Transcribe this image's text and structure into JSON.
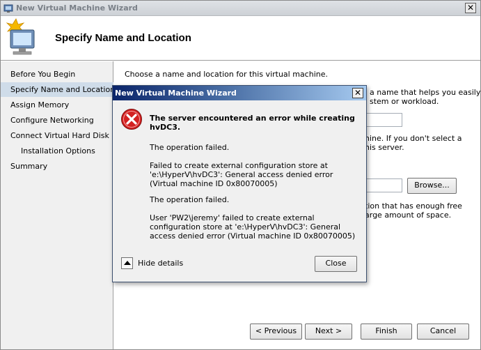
{
  "window": {
    "title": "New Virtual Machine Wizard",
    "close_glyph": "✕",
    "header_title": "Specify Name and Location"
  },
  "nav": {
    "items": [
      {
        "label": "Before You Begin"
      },
      {
        "label": "Specify Name and Location"
      },
      {
        "label": "Assign Memory"
      },
      {
        "label": "Configure Networking"
      },
      {
        "label": "Connect Virtual Hard Disk"
      },
      {
        "label": "Installation Options"
      },
      {
        "label": "Summary"
      }
    ],
    "selected": "Specify Name and Location"
  },
  "content": {
    "intro": "Choose a name and location for this virtual machine.",
    "frag1a": "a name that helps you easily",
    "frag1b": "stem or workload.",
    "frag2a": "hine. If you don't select a",
    "frag2b": "his server.",
    "frag3a": "tion that has enough free",
    "frag3b": "arge amount of space.",
    "browse_label": "Browse..."
  },
  "footer": {
    "previous_label": "< Previous",
    "next_label": "Next >",
    "finish_label": "Finish",
    "cancel_label": "Cancel"
  },
  "dialog": {
    "title": "New Virtual Machine Wizard",
    "close_glyph": "✕",
    "heading": "The server encountered an error while creating hvDC3.",
    "msg1": "The operation failed.",
    "msg2": "Failed to create external configuration store at 'e:\\HyperV\\hvDC3': General access denied error (Virtual machine ID 0x80070005)",
    "msg3": "The operation failed.",
    "msg4": "User 'PW2\\jeremy' failed to create external configuration store at 'e:\\HyperV\\hvDC3': General access denied error (Virtual machine ID 0x80070005)",
    "hide_details_label": "Hide details",
    "close_label": "Close"
  },
  "colors": {
    "dialog_title_start": "#0a246a",
    "error_red": "#d32020",
    "nav_selected": "#cfdce9"
  }
}
